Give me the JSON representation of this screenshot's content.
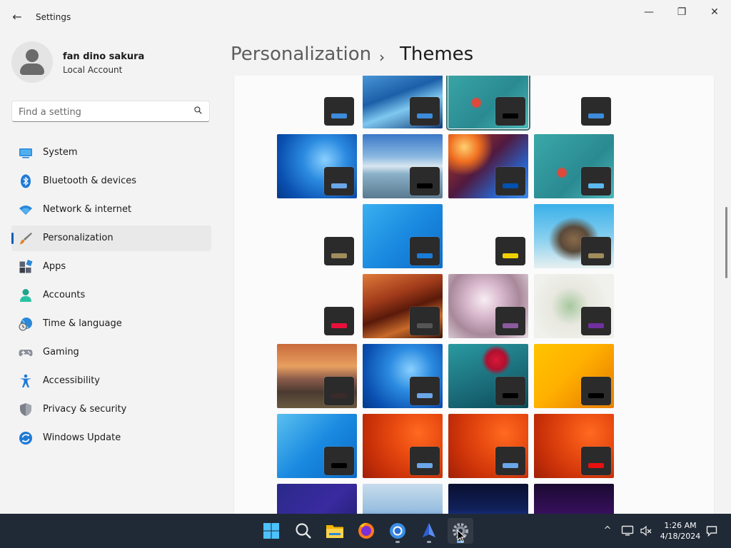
{
  "app": {
    "title": "Settings",
    "back_glyph": "←"
  },
  "window_controls": {
    "minimize": "—",
    "maximize": "❐",
    "close": "✕"
  },
  "user": {
    "name": "fan dino sakura",
    "account_type": "Local Account"
  },
  "search": {
    "placeholder": "Find a setting",
    "value": ""
  },
  "nav": {
    "items": [
      {
        "label": "System",
        "icon": "monitor-icon"
      },
      {
        "label": "Bluetooth & devices",
        "icon": "bluetooth-icon"
      },
      {
        "label": "Network & internet",
        "icon": "wifi-icon"
      },
      {
        "label": "Personalization",
        "icon": "paintbrush-icon",
        "active": true
      },
      {
        "label": "Apps",
        "icon": "apps-icon"
      },
      {
        "label": "Accounts",
        "icon": "person-icon"
      },
      {
        "label": "Time & language",
        "icon": "globe-clock-icon"
      },
      {
        "label": "Gaming",
        "icon": "gamepad-icon"
      },
      {
        "label": "Accessibility",
        "icon": "accessibility-icon"
      },
      {
        "label": "Privacy & security",
        "icon": "shield-icon"
      },
      {
        "label": "Windows Update",
        "icon": "update-icon"
      }
    ]
  },
  "breadcrumb": {
    "parent": "Personalization",
    "separator": "›",
    "current": "Themes"
  },
  "themes": [
    {
      "bg": "plain-white",
      "accent": "#3d8bdc"
    },
    {
      "bg": "glow-blue-vista",
      "accent": "#3d8bdc"
    },
    {
      "bg": "teal-flower",
      "accent": "#000000",
      "selected": true
    },
    {
      "bg": "plain-white",
      "accent": "#3d8bdc"
    },
    {
      "bg": "win7-blue",
      "accent": "#6aa6e8"
    },
    {
      "bg": "beach",
      "accent": "#000000"
    },
    {
      "bg": "sunset-face",
      "accent": "#0050b0"
    },
    {
      "bg": "teal-flower",
      "accent": "#5cb8f0"
    },
    {
      "bg": "plain-white",
      "accent": "#a08c5c"
    },
    {
      "bg": "plain-blue",
      "accent": "#1a7cd8"
    },
    {
      "bg": "plain-white",
      "accent": "#f0d000"
    },
    {
      "bg": "fantasy-turtle",
      "accent": "#a08c5c"
    },
    {
      "bg": "plain-white",
      "accent": "#e8103a"
    },
    {
      "bg": "red-canyon",
      "accent": "#555555"
    },
    {
      "bg": "white-flower",
      "accent": "#8a5a9c"
    },
    {
      "bg": "floral-art",
      "accent": "#7030a0"
    },
    {
      "bg": "mountain-sunset",
      "accent": "#3a2a2a"
    },
    {
      "bg": "win7-blue",
      "accent": "#6aa6e8"
    },
    {
      "bg": "teal-red-flower",
      "accent": "#000000"
    },
    {
      "bg": "orange-yellow",
      "accent": "#000000"
    },
    {
      "bg": "blue-bridge",
      "accent": "#000000"
    },
    {
      "bg": "orange-swirl",
      "accent": "#6aa6e8"
    },
    {
      "bg": "orange-swirl",
      "accent": "#6aa6e8"
    },
    {
      "bg": "orange-swirl",
      "accent": "#e81010"
    },
    {
      "bg": "navy-pattern",
      "accent": "#3d8bdc"
    },
    {
      "bg": "bloom-light",
      "accent": "#3d8bdc"
    },
    {
      "bg": "bloom-dark",
      "accent": "#3d8bdc"
    },
    {
      "bg": "purple-gradient",
      "accent": "#3d8bdc"
    }
  ],
  "taskbar": {
    "apps": [
      {
        "name": "start-icon"
      },
      {
        "name": "search-icon"
      },
      {
        "name": "file-explorer-icon"
      },
      {
        "name": "firefox-icon"
      },
      {
        "name": "chrome-icon",
        "running": true
      },
      {
        "name": "app-icon",
        "running": true
      },
      {
        "name": "settings-icon",
        "running": true,
        "active": true
      }
    ],
    "tray": {
      "chevron": "^"
    },
    "clock": {
      "time": "1:26 AM",
      "date": "4/18/2024"
    }
  }
}
